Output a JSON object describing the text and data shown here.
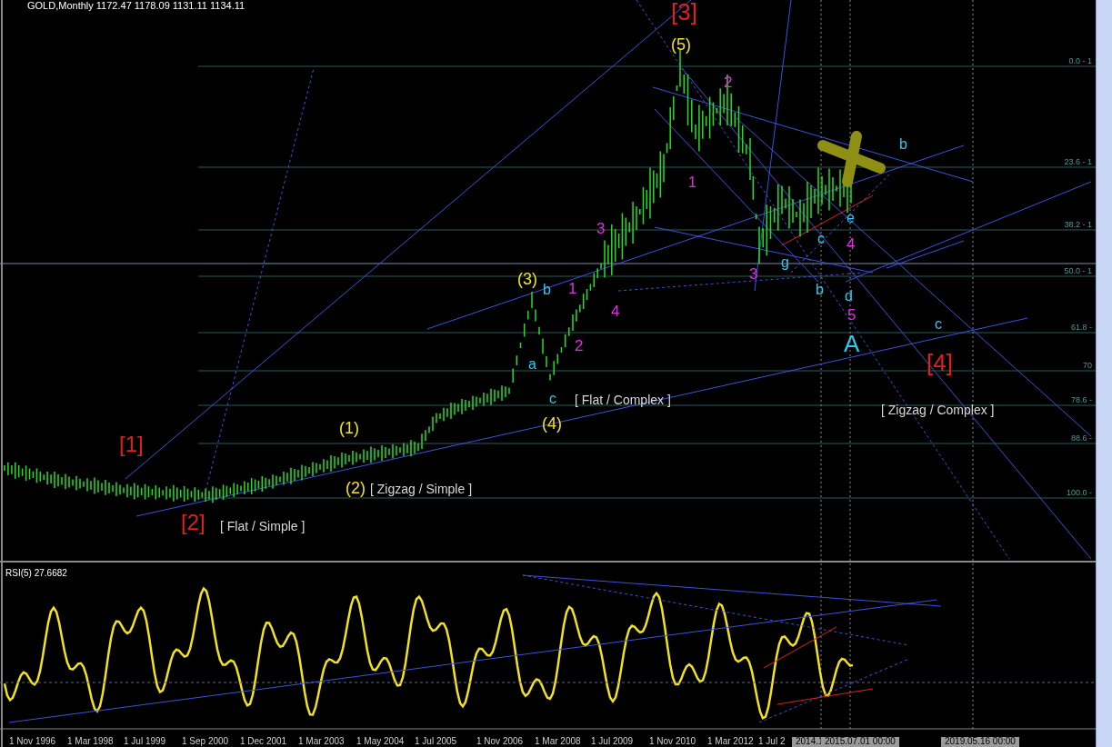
{
  "chart_header": "GOLD,Monthly  1172.47 1178.09 1131.11 1134.11",
  "fib_levels": [
    "0.0 - 1",
    "23.6 - 1",
    "38.2 - 1",
    "50.0 - 1",
    "61.8 -",
    "70",
    "78.6 -",
    "88.6 -",
    "100.0 -"
  ],
  "wave_labels": [
    {
      "text": "[3]",
      "color": "#e0201c"
    },
    {
      "text": "(5)",
      "color": "#f2e21e"
    },
    {
      "text": "2",
      "color": "#e02ee0"
    },
    {
      "text": "b",
      "color": "#2ec8f0"
    },
    {
      "text": "1",
      "color": "#e02ee0"
    },
    {
      "text": "3",
      "color": "#e02ee0"
    },
    {
      "text": "e",
      "color": "#2ec8f0"
    },
    {
      "text": "c",
      "color": "#2ec8f0"
    },
    {
      "text": "4",
      "color": "#e02ee0"
    },
    {
      "text": "g",
      "color": "#2ec8f0"
    },
    {
      "text": "3",
      "color": "#e02ee0"
    },
    {
      "text": "(3)",
      "color": "#f2e21e"
    },
    {
      "text": "b",
      "color": "#2ec8f0"
    },
    {
      "text": "1",
      "color": "#e02ee0"
    },
    {
      "text": "4",
      "color": "#e02ee0"
    },
    {
      "text": "b",
      "color": "#2ec8f0"
    },
    {
      "text": "d",
      "color": "#2ec8f0"
    },
    {
      "text": "5",
      "color": "#e02ee0"
    },
    {
      "text": "2",
      "color": "#e02ee0"
    },
    {
      "text": "A",
      "color": "#2ec8f0"
    },
    {
      "text": "c",
      "color": "#2ec8f0"
    },
    {
      "text": "[4]",
      "color": "#e0201c"
    },
    {
      "text": "a",
      "color": "#2ec8f0"
    },
    {
      "text": "c",
      "color": "#2ec8f0"
    },
    {
      "text": "[ Flat / Complex ]",
      "color": "#d8d8d8"
    },
    {
      "text": "(4)",
      "color": "#f2e21e"
    },
    {
      "text": "[ Zigzag / Complex ]",
      "color": "#d8d8d8"
    },
    {
      "text": "(1)",
      "color": "#f2e21e"
    },
    {
      "text": "[1]",
      "color": "#e0201c"
    },
    {
      "text": "(2)",
      "color": "#f2e21e"
    },
    {
      "text": "[ Zigzag / Simple ]",
      "color": "#d8d8d8"
    },
    {
      "text": "[2]",
      "color": "#e0201c"
    },
    {
      "text": "[ Flat / Simple ]",
      "color": "#d8d8d8"
    }
  ],
  "rsi_header": "RSI(5) 27.6682",
  "time_axis": [
    {
      "text": "1 Nov 1996",
      "kind": "date"
    },
    {
      "text": "1 Mar 1998",
      "kind": "date"
    },
    {
      "text": "1 Jul 1999",
      "kind": "date"
    },
    {
      "text": "1 Sep 2000",
      "kind": "date"
    },
    {
      "text": "1 Dec 2001",
      "kind": "date"
    },
    {
      "text": "1 Mar 2003",
      "kind": "date"
    },
    {
      "text": "1 May 2004",
      "kind": "date"
    },
    {
      "text": "1 Jul 2005",
      "kind": "date"
    },
    {
      "text": "1 Nov 2006",
      "kind": "date"
    },
    {
      "text": "1 Mar 2008",
      "kind": "date"
    },
    {
      "text": "1 Jul 2009",
      "kind": "date"
    },
    {
      "text": "1 Nov 2010",
      "kind": "date"
    },
    {
      "text": "1 Mar 2012",
      "kind": "date"
    },
    {
      "text": "1 Jul 2",
      "kind": "date"
    },
    {
      "text": "2014.1",
      "kind": "cursor"
    },
    {
      "text": "2015.07.01 00:00",
      "kind": "cursor"
    },
    {
      "text": "2019.05.16 00:00",
      "kind": "cursor"
    }
  ]
}
